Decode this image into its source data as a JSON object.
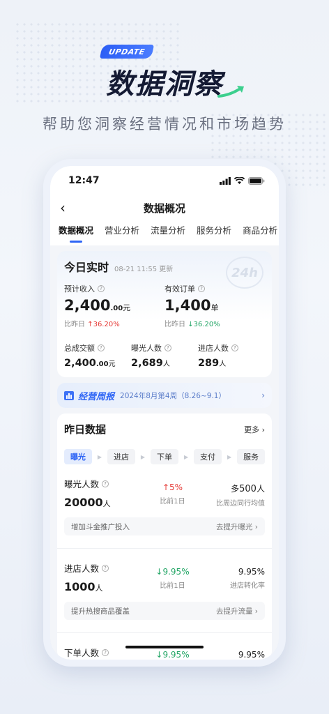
{
  "promo": {
    "badge": "UPDATE",
    "headline": "数据洞察",
    "subtitle": "帮助您洞察经营情况和市场趋势"
  },
  "status": {
    "time": "12:47"
  },
  "nav": {
    "title": "数据概况",
    "back_icon": "chevron-left-icon"
  },
  "tabs": [
    {
      "label": "数据概况",
      "active": true
    },
    {
      "label": "营业分析"
    },
    {
      "label": "流量分析"
    },
    {
      "label": "服务分析"
    },
    {
      "label": "商品分析"
    }
  ],
  "today": {
    "title": "今日实时",
    "timestamp": "08-21 11:55 更新",
    "deco": "24h",
    "revenue": {
      "label": "预计收入",
      "int": "2,400",
      "dec": ".00",
      "unit": "元",
      "cmp_label": "比昨日",
      "cmp_arrow": "↑",
      "cmp_value": "36.20%"
    },
    "orders": {
      "label": "有效订单",
      "value": "1,400",
      "unit": "单",
      "cmp_label": "比昨日",
      "cmp_arrow": "↓",
      "cmp_value": "36.20%"
    },
    "gmv": {
      "label": "总成交额",
      "int": "2,400",
      "dec": ".00",
      "unit": "元"
    },
    "exposure": {
      "label": "曝光人数",
      "value": "2,689",
      "unit": "人"
    },
    "visitors": {
      "label": "进店人数",
      "value": "289",
      "unit": "人"
    }
  },
  "weekly": {
    "title": "经营周报",
    "period": "2024年8月第4周（8.26~9.1）"
  },
  "yesterday": {
    "title": "昨日数据",
    "more": "更多",
    "steps": [
      "曝光",
      "进店",
      "下单",
      "支付",
      "服务"
    ],
    "metrics": [
      {
        "label": "曝光人数",
        "value": "20000",
        "unit": "人",
        "arrow": "↑",
        "pct": "5%",
        "pct_label": "比前1日",
        "dir": "up",
        "peer_prefix": "多",
        "peer_value": "500",
        "peer_unit": "人",
        "peer_label": "比周边同行均值",
        "tip": "增加斗金推广投入",
        "tip_link": "去提升曝光"
      },
      {
        "label": "进店人数",
        "value": "1000",
        "unit": "人",
        "arrow": "↓",
        "pct": "9.95%",
        "pct_label": "比前1日",
        "dir": "down",
        "peer_value": "9.95%",
        "peer_label": "进店转化率",
        "tip": "提升热搜商品覆盖",
        "tip_link": "去提升流量"
      },
      {
        "label": "下单人数",
        "arrow": "↓",
        "pct": "9.95%",
        "dir": "down",
        "peer_value": "9.95%"
      }
    ]
  }
}
